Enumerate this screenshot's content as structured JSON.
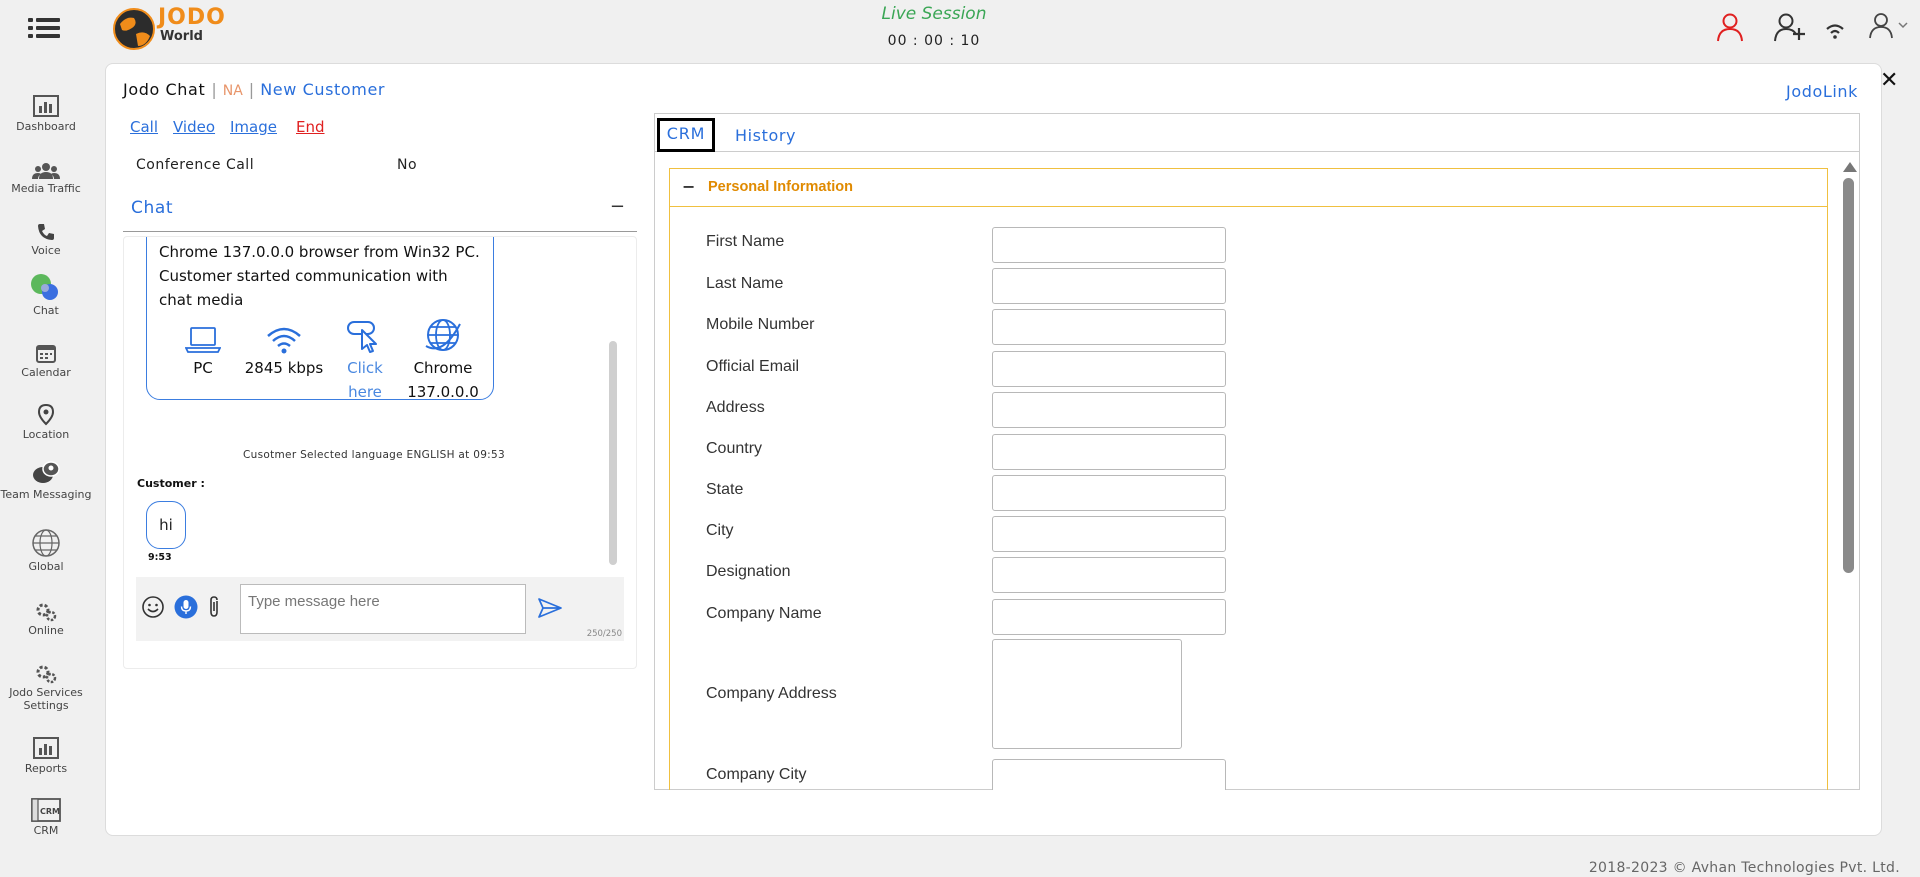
{
  "header": {
    "logo_text": "JODO",
    "logo_subtext": "World",
    "session_label": "Live Session",
    "session_timer": "00 : 00 : 10",
    "icons": [
      "menu-icon",
      "agent-alert-icon",
      "add-user-icon",
      "signal-icon",
      "user-profile-icon"
    ]
  },
  "sidebar": {
    "items": [
      {
        "label": "Dashboard",
        "icon": "dashboard-icon"
      },
      {
        "label": "Media Traffic",
        "icon": "people-icon"
      },
      {
        "label": "Voice",
        "icon": "phone-icon"
      },
      {
        "label": "Chat",
        "icon": "chat-icon"
      },
      {
        "label": "Calendar",
        "icon": "calendar-icon"
      },
      {
        "label": "Location",
        "icon": "location-pin-icon"
      },
      {
        "label": "Team Messaging",
        "icon": "team-chat-icon"
      },
      {
        "label": "Global",
        "icon": "globe-icon"
      },
      {
        "label": "Online",
        "icon": "gears-icon"
      },
      {
        "label": "Jodo Services Settings",
        "icon": "settings-gears-icon"
      },
      {
        "label": "Reports",
        "icon": "reports-icon"
      },
      {
        "label": "CRM",
        "icon": "crm-icon"
      }
    ]
  },
  "chat_window": {
    "title": "Jodo Chat",
    "separator": "|",
    "status": "NA",
    "customer_type": "New Customer",
    "jodolink": "JodoLink",
    "actions": {
      "call": "Call",
      "video": "Video",
      "image": "Image",
      "end": "End"
    },
    "conference_label": "Conference Call",
    "conference_value": "No",
    "chat_heading": "Chat",
    "minimize": "−",
    "close": "✕"
  },
  "messages": {
    "system_text_line1": "Chrome 137.0.0.0 browser from Win32 PC.",
    "system_text_line2": "Customer started communication with chat media",
    "stats": {
      "device": "PC",
      "bandwidth": "2845 kbps",
      "link_line1": "Click",
      "link_line2": "here",
      "browser_line1": "Chrome",
      "browser_line2": "137.0.0.0"
    },
    "language_note": "Cusotmer Selected language ENGLISH at 09:53",
    "customer_label": "Customer :",
    "customer_message": "hi",
    "customer_time": "9:53"
  },
  "composer": {
    "placeholder": "Type message here",
    "char_count": "250/250"
  },
  "crm_panel": {
    "tabs": [
      "CRM",
      "History"
    ],
    "active_tab": "CRM",
    "section_toggle": "−",
    "section_title": "Personal Information",
    "fields": [
      {
        "label": "First Name",
        "value": ""
      },
      {
        "label": "Last Name",
        "value": ""
      },
      {
        "label": "Mobile Number",
        "value": ""
      },
      {
        "label": "Official Email",
        "value": ""
      },
      {
        "label": "Address",
        "value": ""
      },
      {
        "label": "Country",
        "value": ""
      },
      {
        "label": "State",
        "value": ""
      },
      {
        "label": "City",
        "value": ""
      },
      {
        "label": "Designation",
        "value": ""
      },
      {
        "label": "Company Name",
        "value": ""
      },
      {
        "label": "Company Address",
        "value": ""
      },
      {
        "label": "Company City",
        "value": ""
      }
    ]
  },
  "footer": {
    "copyright": "2018-2023 © Avhan Technologies Pvt. Ltd."
  },
  "colors": {
    "accent_blue": "#2a6fdb",
    "live_green": "#3aa655",
    "end_red": "#e02020",
    "section_orange": "#e08a00",
    "status_na": "#e8956a"
  }
}
